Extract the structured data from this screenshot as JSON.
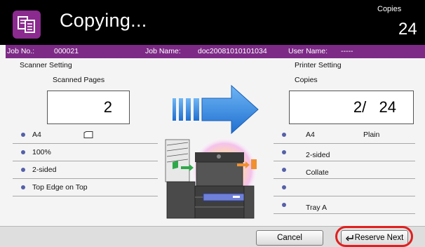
{
  "header": {
    "title": "Copying...",
    "copies_label": "Copies",
    "copies_value": "24",
    "icon": "copy-document-icon"
  },
  "job": {
    "job_no_label": "Job No.:",
    "job_no": "000021",
    "job_name_label": "Job Name:",
    "job_name": "doc20081010101034",
    "user_name_label": "User Name:",
    "user_name": "-----"
  },
  "scanner": {
    "heading": "Scanner Setting",
    "count_label": "Scanned Pages",
    "count": "2",
    "rows": [
      {
        "text": "A4",
        "icon": "paper-orientation-icon"
      },
      {
        "text": "100%"
      },
      {
        "text": "2-sided"
      },
      {
        "text": "Top Edge on Top"
      }
    ]
  },
  "printer": {
    "heading": "Printer Setting",
    "count_label": "Copies",
    "count": "2/   24",
    "rows": [
      {
        "text": "A4",
        "extra": "Plain"
      },
      {
        "text": "2-sided"
      },
      {
        "text": "Collate"
      },
      {
        "text": ""
      },
      {
        "text": "Tray A"
      }
    ]
  },
  "footer": {
    "cancel_label": "Cancel",
    "reserve_label": "Reserve Next",
    "reserve_icon": "return-arrow-icon"
  },
  "colors": {
    "header_bg": "#000000",
    "accent_purple": "#7d2a87",
    "arrow_blue": "#3a8de0",
    "highlight_red": "#e0201f"
  }
}
